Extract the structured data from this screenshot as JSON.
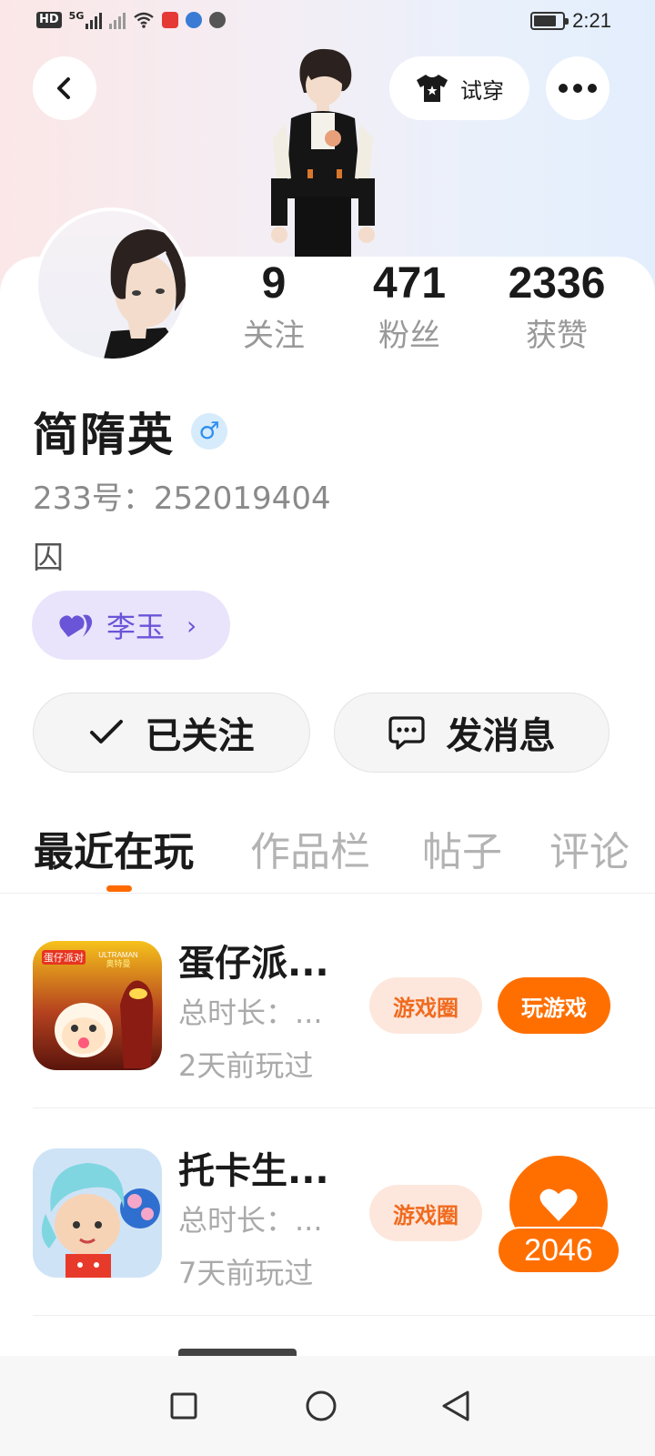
{
  "status_bar": {
    "time": "2:21",
    "network_label": "5G",
    "hd_label": "HD"
  },
  "header": {
    "tryon_label": "试穿"
  },
  "profile": {
    "stats": [
      {
        "value": "9",
        "label": "关注"
      },
      {
        "value": "471",
        "label": "粉丝"
      },
      {
        "value": "2336",
        "label": "获赞"
      }
    ],
    "name": "简隋英",
    "gender_symbol": "♂",
    "uid_text": "233号：252019404",
    "bio": "囚",
    "relation_name": "李玉",
    "relation_chevron": "›"
  },
  "actions": {
    "follow_label": "已关注",
    "message_label": "发消息"
  },
  "tabs": [
    "最近在玩",
    "作品栏",
    "帖子",
    "评论"
  ],
  "games": [
    {
      "title": "蛋仔派...",
      "duration": "总时长：...",
      "last_played": "2天前玩过",
      "circle_label": "游戏圈",
      "play_label": "玩游戏",
      "icon_banner": "蛋仔派对",
      "icon_brand": "ULTRAMAN",
      "icon_brand_cn": "奥特曼"
    },
    {
      "title": "托卡生...",
      "duration": "总时长：...",
      "last_played": "7天前玩过",
      "circle_label": "游戏圈"
    }
  ],
  "like_float": {
    "count": "2046"
  },
  "colors": {
    "accent": "#ff6f00",
    "relation_bg": "#e9e4fb",
    "relation_text": "#6a55d8",
    "gender_bg": "#d6ebfb"
  }
}
